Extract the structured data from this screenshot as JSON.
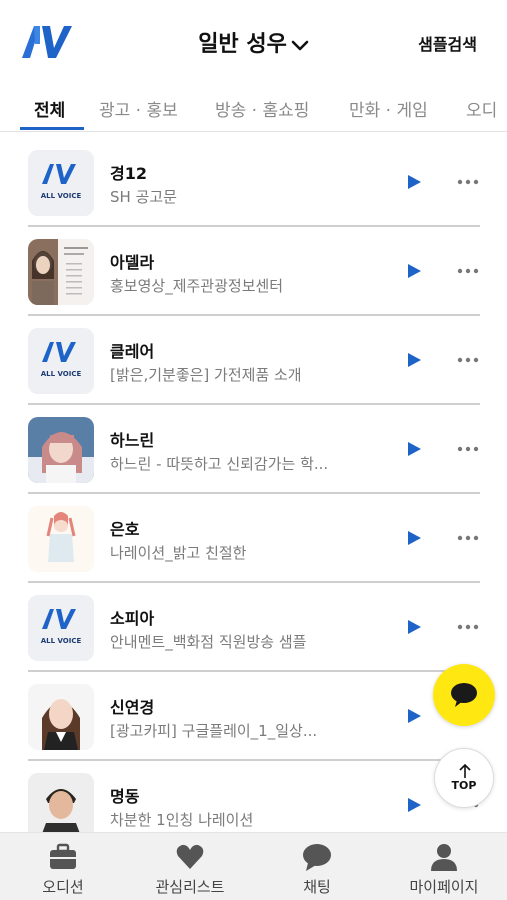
{
  "header": {
    "logo_text": "AV",
    "title": "일반 성우",
    "sample_search": "샘플검색"
  },
  "tabs": [
    {
      "label": "전체",
      "active": true
    },
    {
      "label": "광고 · 홍보",
      "active": false
    },
    {
      "label": "방송 · 홈쇼핑",
      "active": false
    },
    {
      "label": "만화 · 게임",
      "active": false
    },
    {
      "label": "오디",
      "active": false
    }
  ],
  "voices": [
    {
      "name": "경12",
      "desc": "SH 공고문",
      "thumb": "allvoice-logo"
    },
    {
      "name": "아델라",
      "desc": "홍보영상_제주관광정보센터",
      "thumb": "photo"
    },
    {
      "name": "클레어",
      "desc": "[밝은,기분좋은] 가전제품 소개",
      "thumb": "allvoice-logo"
    },
    {
      "name": "하느린",
      "desc": "하느린 - 따뜻하고 신뢰감가는 학...",
      "thumb": "photo"
    },
    {
      "name": "은호",
      "desc": "나레이션_밝고 친절한",
      "thumb": "illustration"
    },
    {
      "name": "소피아",
      "desc": "안내멘트_백화점 직원방송 샘플",
      "thumb": "allvoice-logo"
    },
    {
      "name": "신연경",
      "desc": "[광고카피] 구글플레이_1_일상...",
      "thumb": "photo"
    },
    {
      "name": "명동",
      "desc": "차분한 1인칭 나레이션",
      "thumb": "photo"
    }
  ],
  "thumb_logo_text": "ALL VOICE",
  "floating": {
    "top_label": "TOP"
  },
  "bottom_nav": [
    {
      "label": "오디션",
      "icon": "briefcase-icon"
    },
    {
      "label": "관심리스트",
      "icon": "heart-icon"
    },
    {
      "label": "채팅",
      "icon": "chat-icon"
    },
    {
      "label": "마이페이지",
      "icon": "person-icon"
    }
  ],
  "colors": {
    "accent": "#1e63c8",
    "kakao": "#ffe812",
    "nav_icon": "#555555"
  }
}
